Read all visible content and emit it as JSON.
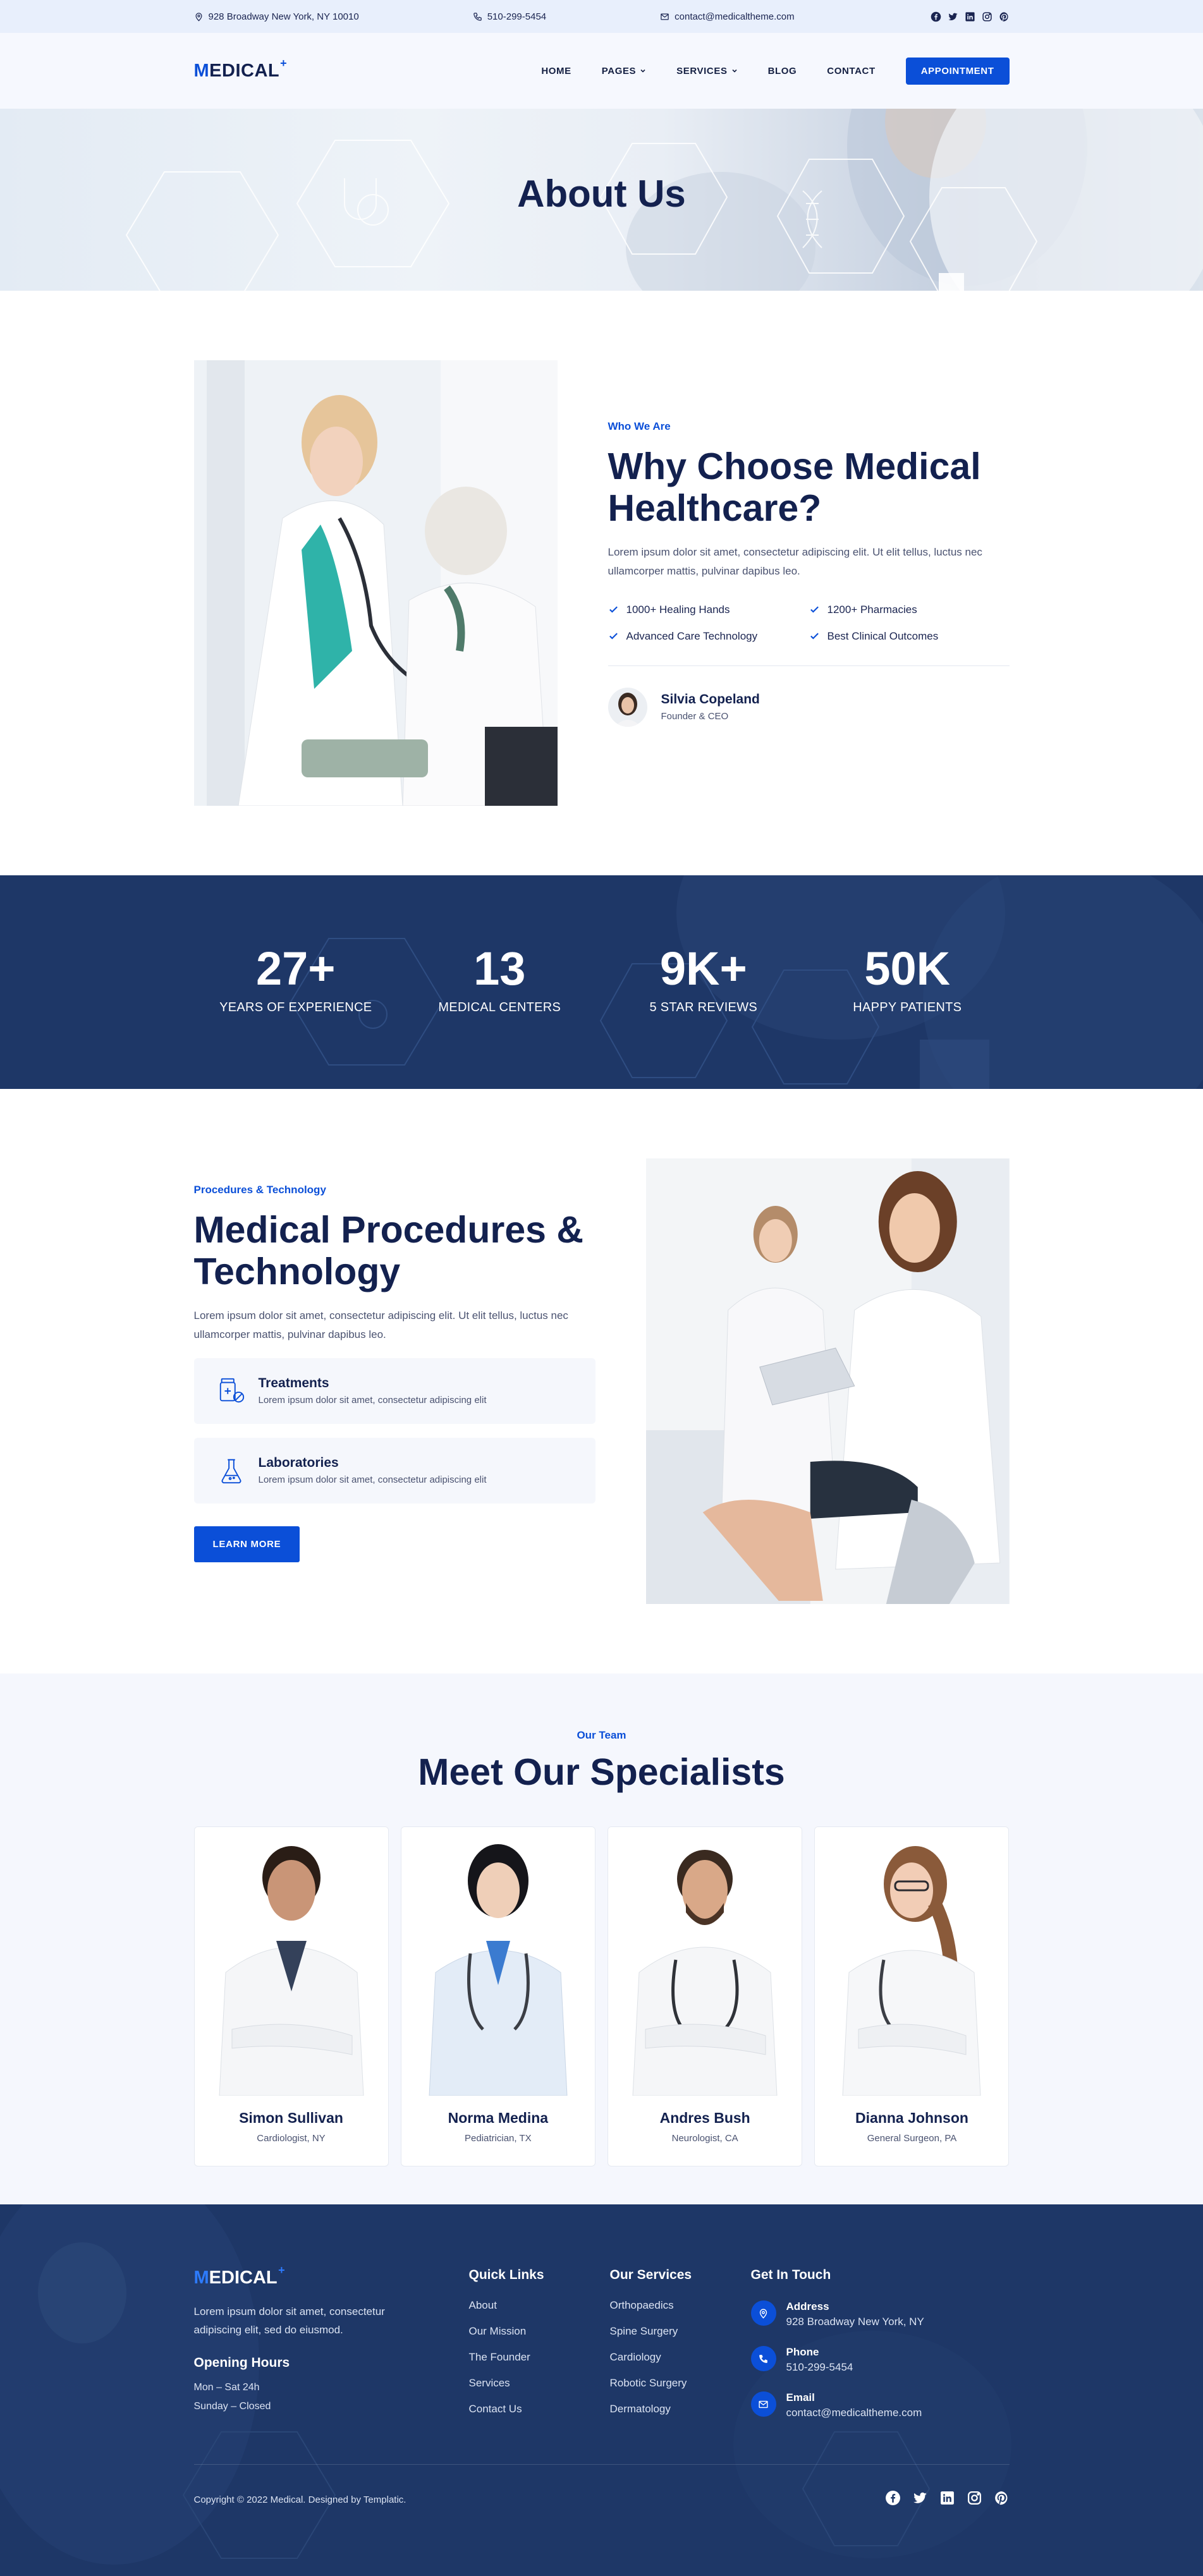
{
  "topbar": {
    "address": "928 Broadway New York, NY 10010",
    "phone": "510-299-5454",
    "email": "contact@medicaltheme.com",
    "social_icons": [
      "facebook-icon",
      "twitter-icon",
      "linkedin-icon",
      "instagram-icon",
      "pinterest-icon"
    ]
  },
  "header": {
    "logo_accent": "M",
    "logo_rest": "EDICAL",
    "logo_plus": "+",
    "nav": {
      "home": "HOME",
      "pages": "PAGES",
      "services": "SERVICES",
      "blog": "BLOG",
      "contact": "CONTACT"
    },
    "cta": "APPOINTMENT"
  },
  "hero": {
    "title": "About Us"
  },
  "about": {
    "eyebrow": "Who We Are",
    "title": "Why Choose Medical Healthcare?",
    "text": "Lorem ipsum dolor sit amet, consectetur adipiscing elit. Ut elit tellus, luctus nec ullamcorper mattis, pulvinar dapibus leo.",
    "features": [
      "1000+ Healing Hands",
      "1200+ Pharmacies",
      "Advanced Care Technology",
      "Best Clinical Outcomes"
    ],
    "founder_name": "Silvia Copeland",
    "founder_role": "Founder & CEO"
  },
  "stats": [
    {
      "value": "27+",
      "label": "YEARS OF EXPERIENCE"
    },
    {
      "value": "13",
      "label": "MEDICAL CENTERS"
    },
    {
      "value": "9K+",
      "label": "5 STAR REVIEWS"
    },
    {
      "value": "50K",
      "label": "HAPPY PATIENTS"
    }
  ],
  "procedures": {
    "eyebrow": "Procedures & Technology",
    "title": "Medical Procedures & Technology",
    "text": "Lorem ipsum dolor sit amet, consectetur adipiscing elit. Ut elit tellus, luctus nec ullamcorper mattis, pulvinar dapibus leo.",
    "cards": [
      {
        "title": "Treatments",
        "desc": "Lorem ipsum dolor sit amet, consectetur adipiscing elit",
        "icon": "pills-icon"
      },
      {
        "title": "Laboratories",
        "desc": "Lorem ipsum dolor sit amet, consectetur adipiscing elit",
        "icon": "flask-icon"
      }
    ],
    "button": "LEARN MORE"
  },
  "team": {
    "eyebrow": "Our Team",
    "title": "Meet Our Specialists",
    "members": [
      {
        "name": "Simon Sullivan",
        "role": "Cardiologist, NY"
      },
      {
        "name": "Norma Medina",
        "role": "Pediatrician, TX"
      },
      {
        "name": "Andres Bush",
        "role": "Neurologist, CA"
      },
      {
        "name": "Dianna Johnson",
        "role": "General Surgeon, PA"
      }
    ]
  },
  "footer": {
    "logo_accent": "M",
    "logo_rest": "EDICAL",
    "logo_plus": "+",
    "desc": "Lorem ipsum dolor sit amet, consectetur adipiscing elit, sed do eiusmod.",
    "hours_title": "Opening Hours",
    "hours_1": "Mon – Sat 24h",
    "hours_2": "Sunday – Closed",
    "quick_title": "Quick Links",
    "quick_links": [
      "About",
      "Our Mission",
      "The Founder",
      "Services",
      "Contact Us"
    ],
    "services_title": "Our Services",
    "services": [
      "Orthopaedics",
      "Spine Surgery",
      "Cardiology",
      "Robotic Surgery",
      "Dermatology"
    ],
    "touch_title": "Get In Touch",
    "address_label": "Address",
    "address": "928 Broadway New York, NY",
    "phone_label": "Phone",
    "phone": "510-299-5454",
    "email_label": "Email",
    "email": "contact@medicaltheme.com",
    "copyright": "Copyright © 2022 Medical. Designed by Templatic."
  },
  "colors": {
    "accent": "#0b4fd8",
    "navy": "#1e3767",
    "heading": "#13214f",
    "topbar": "#e8effc"
  }
}
